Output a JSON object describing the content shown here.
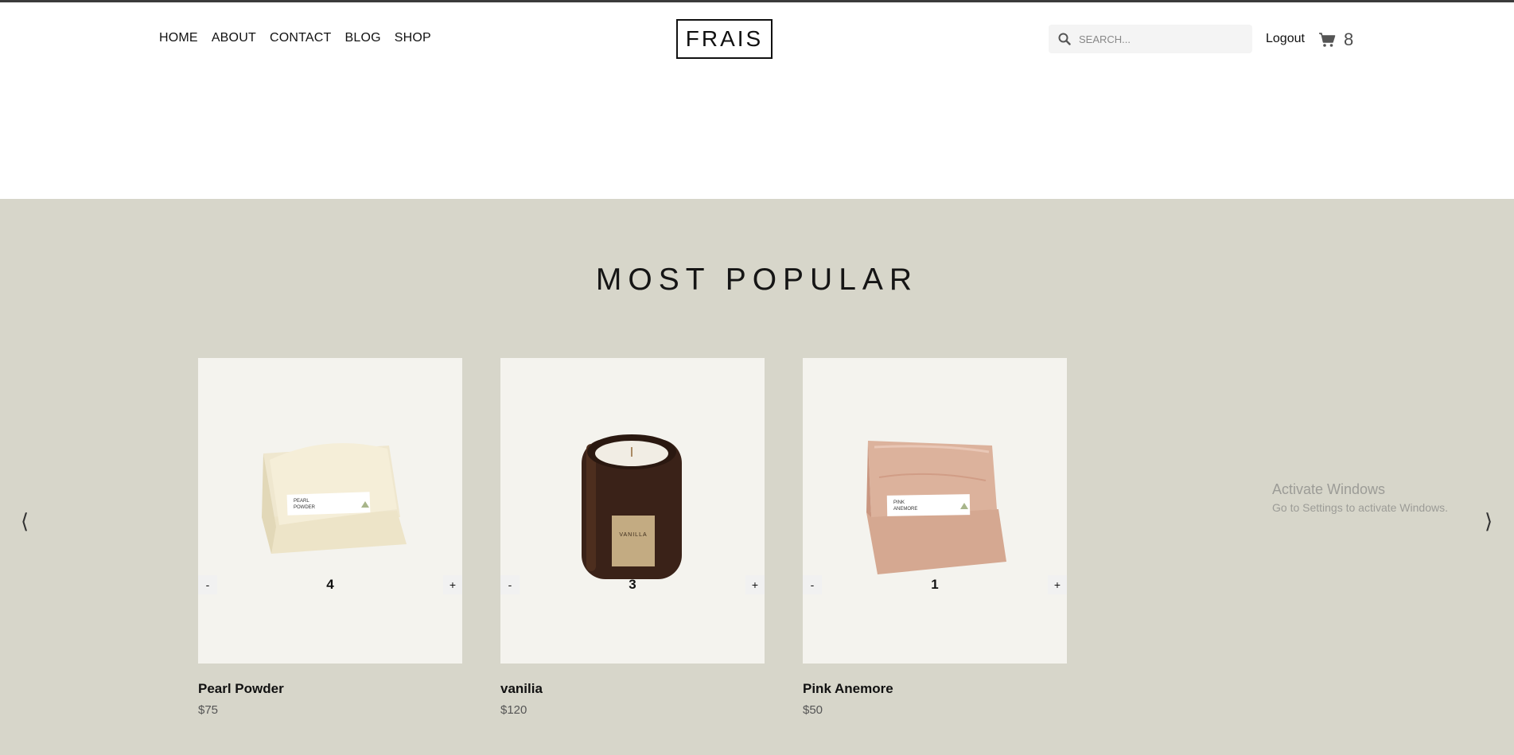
{
  "header": {
    "nav": [
      "HOME",
      "ABOUT",
      "CONTACT",
      "BLOG",
      "SHOP"
    ],
    "logo": "FRAIS",
    "search_placeholder": "SEARCH...",
    "logout": "Logout",
    "cart_count": "8",
    "icons": {
      "search": "search-icon",
      "cart": "cart-icon"
    }
  },
  "popular": {
    "title": "MOST POPULAR",
    "prev_arrow": "⟨",
    "next_arrow": "⟩",
    "products": [
      {
        "name": "Pearl Powder",
        "price": "$75",
        "quantity": "4",
        "label_line1": "PEARL",
        "label_line2": "POWDER"
      },
      {
        "name": "vanilia",
        "price": "$120",
        "quantity": "3",
        "label_line1": "VANILLA"
      },
      {
        "name": "Pink Anemore",
        "price": "$50",
        "quantity": "1",
        "label_line1": "PINK",
        "label_line2": "ANEMORE"
      }
    ],
    "minus": "-",
    "plus": "+"
  },
  "watermark": {
    "line1": "Activate Windows",
    "line2": "Go to Settings to activate Windows."
  },
  "colors": {
    "section_bg": "#d7d6ca",
    "card_bg": "#f4f3ee",
    "text": "#111111"
  }
}
